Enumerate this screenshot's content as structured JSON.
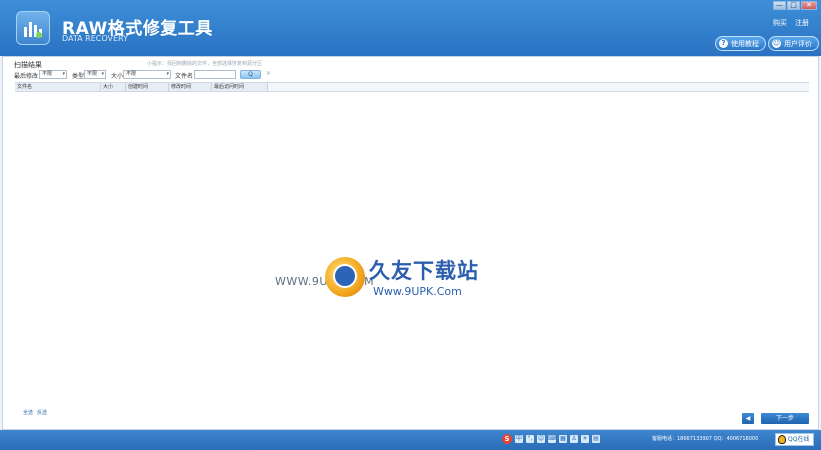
{
  "header": {
    "title": "RAW格式修复工具",
    "subtitle": "DATA RECOVERY",
    "links": [
      "购买",
      "注册"
    ],
    "tutorial_btn": "使用教程",
    "review_btn": "用户评价",
    "window_controls": [
      "—",
      "□",
      "✕"
    ]
  },
  "scan": {
    "section_title": "扫描结果",
    "hint": "小提示：找回到删除的文件，全部选择恢复到源分区",
    "filters": {
      "date_label": "最后修改",
      "date_value": "不限",
      "type_label": "类型",
      "type_value": "不限",
      "size_label": "大小",
      "size_value": "不限",
      "filename_label": "文件名",
      "search_glyph": "Q",
      "clear_glyph": "✕"
    },
    "columns": [
      "文件名",
      "大小",
      "创建时间",
      "修改时间",
      "最后访问时间"
    ]
  },
  "footer": {
    "select_all": "全选",
    "invert": "反选",
    "back_glyph": "◀",
    "next": "下一步"
  },
  "watermark": {
    "left_text": "WWW.9UPK.COM",
    "cn_text": "久友下载站",
    "url": "Www.9UPK.Com"
  },
  "statusbar": {
    "tray": [
      "中",
      "°,",
      "☺",
      "⌨",
      "▦",
      "♙",
      "☀",
      "▤"
    ],
    "hotline": "客服电话：18667133907  QQ：4006718000",
    "qq_label": "QQ在线"
  },
  "colors": {
    "header": "#3e8fd8",
    "accent": "#2a72c2",
    "grid_header": "#e6edf4"
  }
}
